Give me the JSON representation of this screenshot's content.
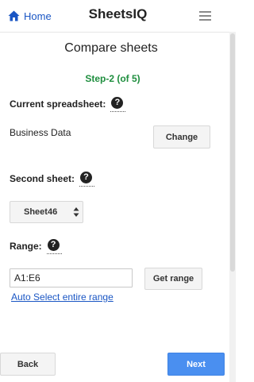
{
  "header": {
    "home_label": "Home",
    "app_title": "SheetsIQ",
    "home_icon": "home-icon",
    "menu_icon": "hamburger-menu-icon"
  },
  "main": {
    "title": "Compare sheets",
    "step": "Step-2 (of 5)",
    "current_spreadsheet": {
      "label": "Current spreadsheet:",
      "help_icon": "?",
      "value": "Business Data",
      "change_button": "Change"
    },
    "second_sheet": {
      "label": "Second sheet:",
      "help_icon": "?",
      "selected": "Sheet46"
    },
    "range": {
      "label": "Range:",
      "help_icon": "?",
      "value": "A1:E6",
      "get_range_button": "Get range",
      "auto_select_link": "Auto Select entire range"
    }
  },
  "footer": {
    "back_button": "Back",
    "next_button": "Next"
  },
  "colors": {
    "link_blue": "#1a56c4",
    "step_green": "#1e8e3e",
    "primary_button": "#4a8ff0"
  }
}
